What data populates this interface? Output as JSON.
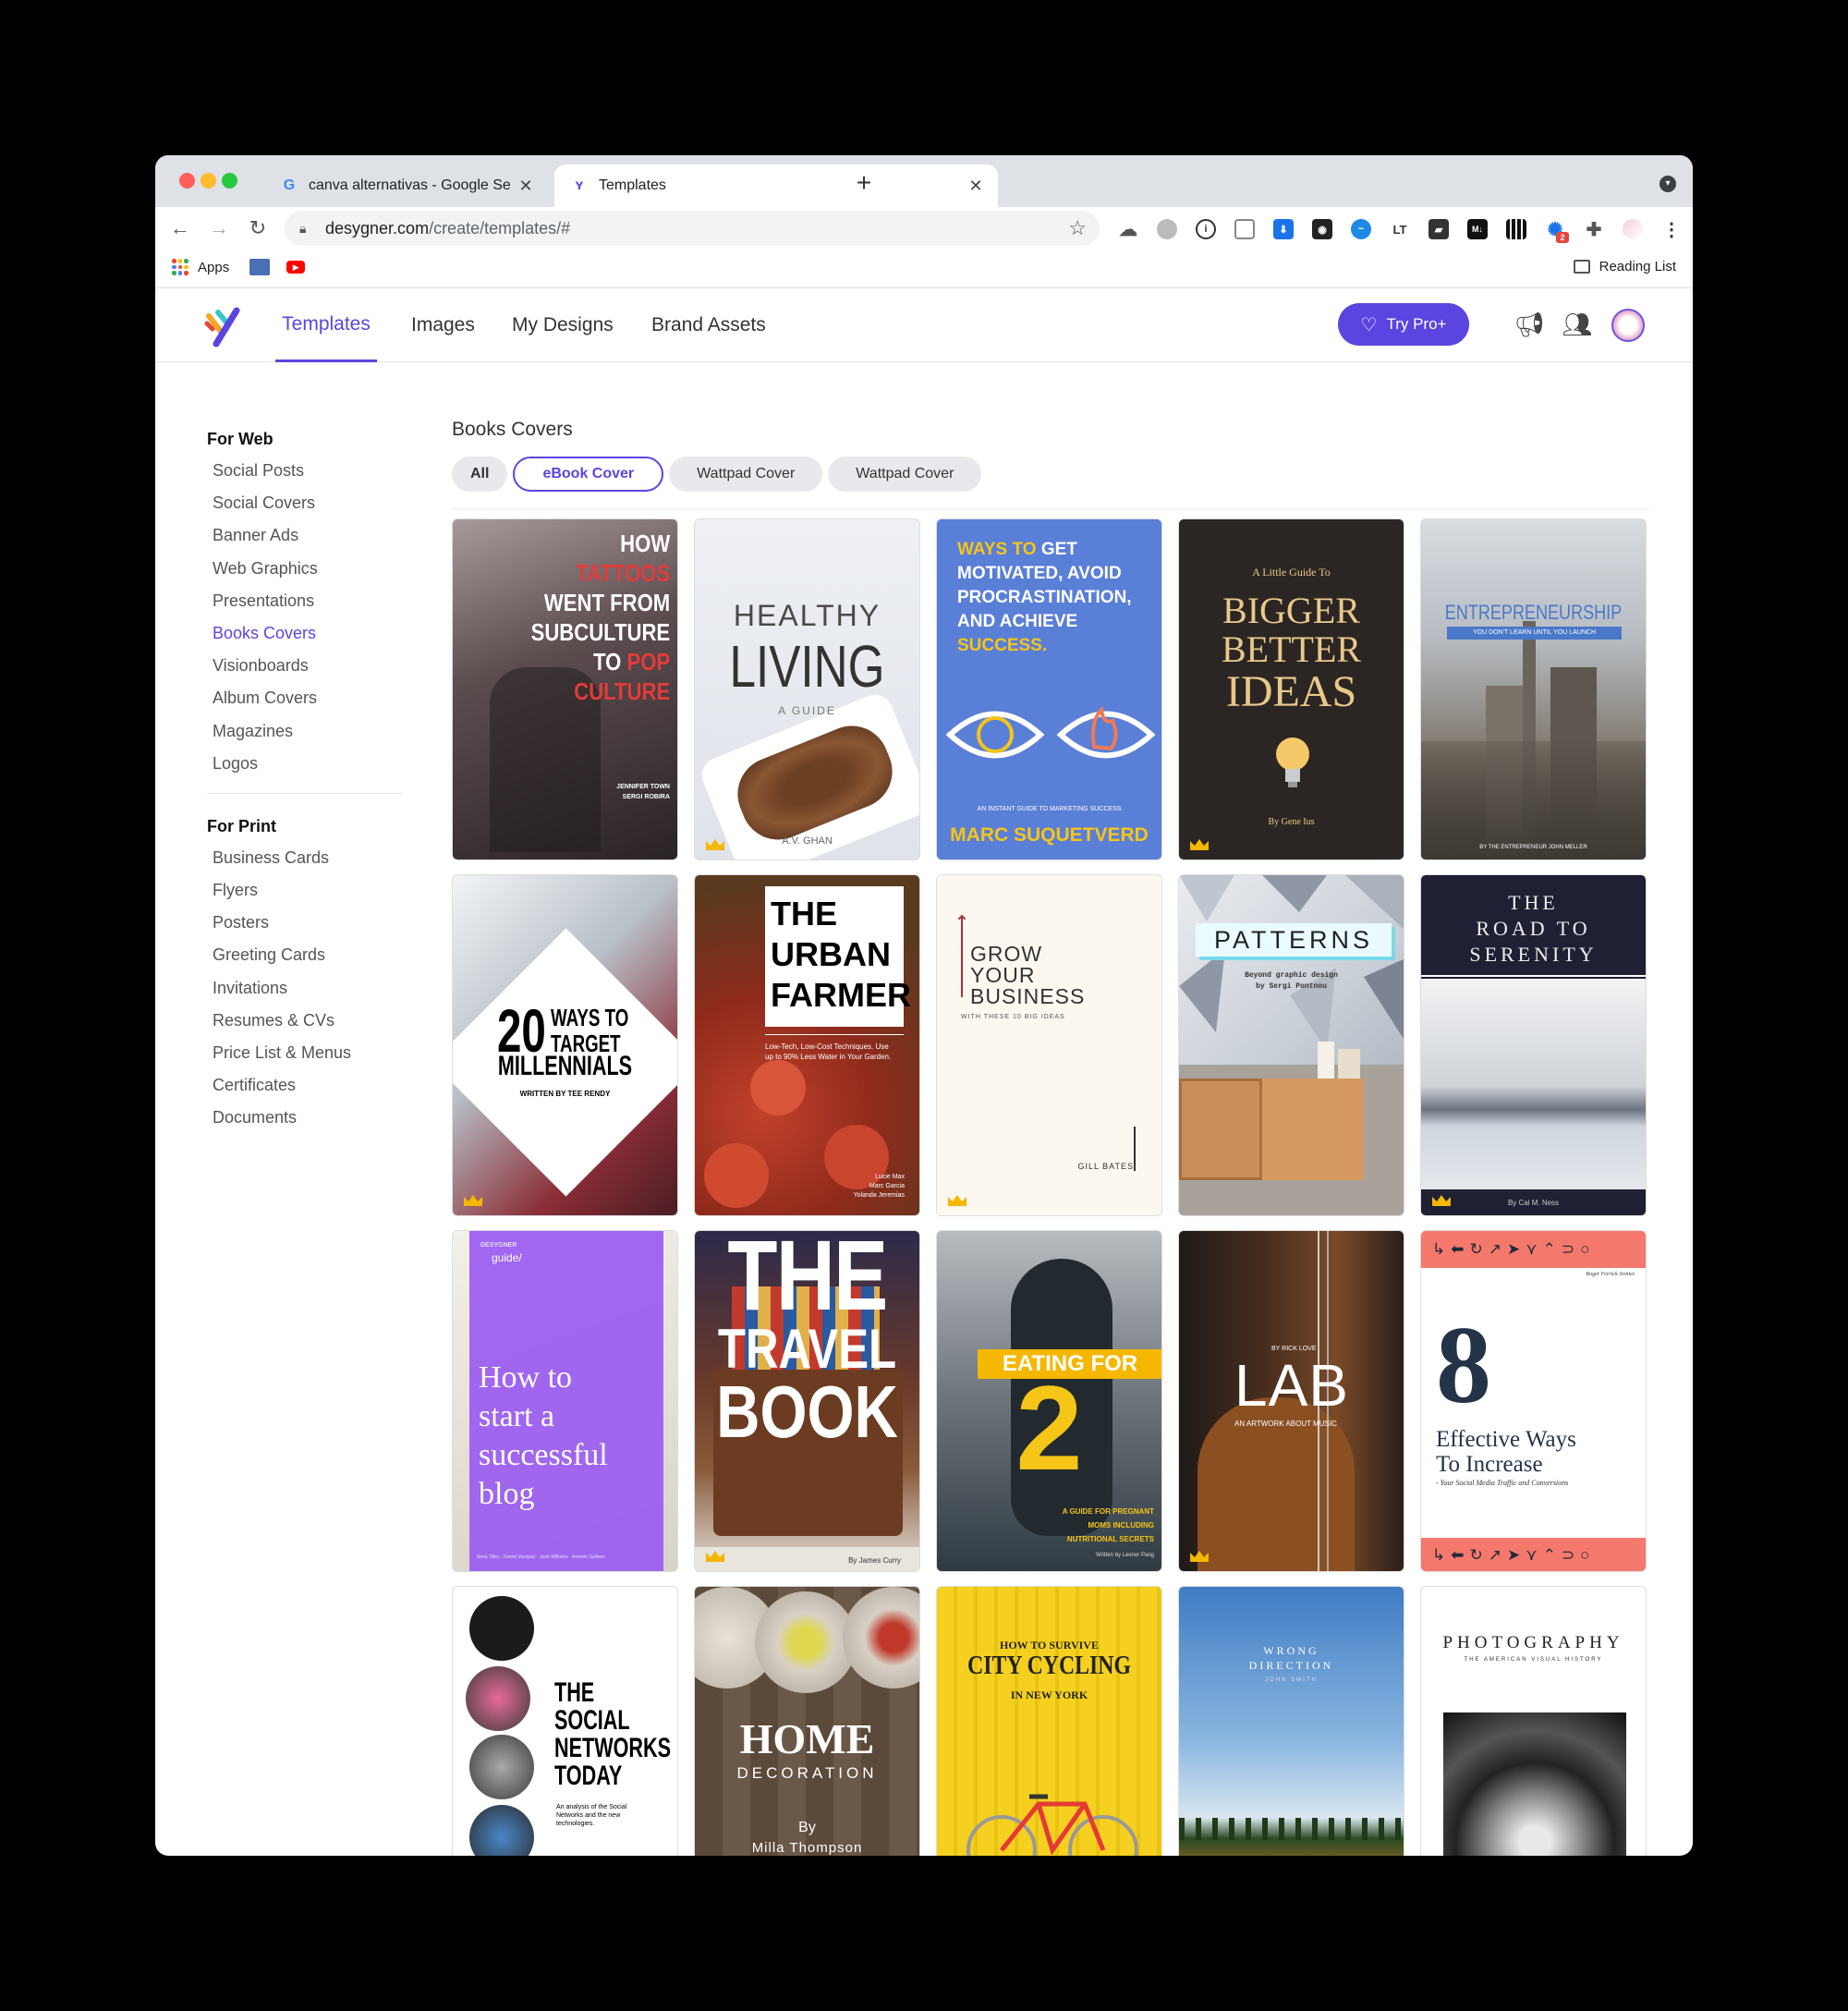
{
  "browser": {
    "tabs": [
      {
        "title": "canva alternativas - Google Se",
        "favicon": "google-icon",
        "active": false
      },
      {
        "title": "Templates",
        "favicon": "desygner-icon",
        "active": true
      }
    ],
    "url_host": "desygner.com",
    "url_path": "/create/templates/#",
    "bookmarks": {
      "apps_label": "Apps",
      "reading_list_label": "Reading List"
    },
    "extension_badge": "2"
  },
  "site": {
    "nav": [
      "Templates",
      "Images",
      "My Designs",
      "Brand Assets"
    ],
    "active_nav": "Templates",
    "try_pro_label": "Try Pro+",
    "accent_color": "#5b45e0"
  },
  "sidebar": {
    "web_heading": "For Web",
    "web_items": [
      "Social Posts",
      "Social Covers",
      "Banner Ads",
      "Web Graphics",
      "Presentations",
      "Books Covers",
      "Visionboards",
      "Album Covers",
      "Magazines",
      "Logos"
    ],
    "print_heading": "For Print",
    "print_items": [
      "Business Cards",
      "Flyers",
      "Posters",
      "Greeting Cards",
      "Invitations",
      "Resumes & CVs",
      "Price List & Menus",
      "Certificates",
      "Documents"
    ],
    "active_item": "Books Covers"
  },
  "content": {
    "title": "Books Covers",
    "filters": [
      "All",
      "eBook Cover",
      "Wattpad Cover",
      "Wattpad Cover"
    ],
    "selected_filter": "eBook Cover"
  },
  "covers": {
    "c1": {
      "l1": "HOW",
      "l2": "TATTOOS",
      "l3": "WENT FROM",
      "l4": "SUBCULTURE",
      "l5a": "TO ",
      "l5b": "POP",
      "l6": "CULTURE",
      "a1": "JENNIFER TOWN",
      "a2": "SERGI ROBIRA"
    },
    "c2": {
      "l1": "HEALTHY",
      "l2": "LIVING",
      "l3": "A GUIDE",
      "author": "A.V. GHAN"
    },
    "c3": {
      "l1a": "WAYS TO ",
      "l1b": "GET",
      "l2": "MOTIVATED, AVOID",
      "l3": "PROCRASTINATION,",
      "l4": "AND ACHIEVE",
      "l5": "SUCCESS.",
      "sub": "AN INSTANT GUIDE TO MARKETING SUCCESS",
      "author": "MARC SUQUETVERD"
    },
    "c4": {
      "pre": "A Little Guide To",
      "l1": "BIGGER",
      "l2": "BETTER",
      "l3": "IDEAS",
      "author": "By Gene Ius"
    },
    "c5": {
      "title": "ENTREPRENEURSHIP",
      "banner": "YOU DON'T LEARN UNTIL YOU LAUNCH",
      "author": "BY THE ENTREPRENEUR JOHN MELLER"
    },
    "c6": {
      "n": "20",
      "l1": "WAYS TO",
      "l2": "TARGET",
      "l3": "MILLENNIALS",
      "by": "WRITTEN BY TEE RENDY"
    },
    "c7": {
      "l1": "THE",
      "l2": "URBAN",
      "l3": "FARMER",
      "desc": "Low-Tech, Low-Cost Techniques. Use up to 90% Less Water in Your Garden.",
      "a1": "Lucie Max",
      "a2": "Marc Garcia",
      "a3": "Yolanda Jeremias"
    },
    "c8": {
      "l1": "GROW",
      "l2": "YOUR",
      "l3": "BUSINESS",
      "sub": "WITH THESE 10 BIG IDEAS",
      "author": "GILL BATES"
    },
    "c9": {
      "title": "PATTERNS",
      "sub1": "Beyond graphic design",
      "sub2": "by Sergi Pontnou"
    },
    "c10": {
      "l1": "THE",
      "l2": "ROAD TO",
      "l3": "SERENITY",
      "author": "By Cal M. Ness"
    },
    "c11": {
      "brand": "DESYGNER",
      "guide": "guide/",
      "l1": "How to",
      "l2": "start a",
      "l3": "successful",
      "l4": "blog",
      "footer": "Anna Tilley · Daniel Vazquez · Jane Williams · Antonio Sullivan"
    },
    "c12": {
      "l1": "THE",
      "l2": "TRAVEL",
      "l3": "BOOK",
      "author": "By James Curry"
    },
    "c13": {
      "l1": "EATING FOR",
      "n": "2",
      "sub1": "A GUIDE FOR PREGNANT",
      "sub2": "MOMS INCLUDING",
      "sub3": "NUTRITIONAL SECRETS",
      "author": "Written by Leonor Pang"
    },
    "c14": {
      "by": "BY RICK LOVE",
      "title": "LAB",
      "sub": "AN ARTWORK ABOUT MUSIC"
    },
    "c15": {
      "author": "Roger Ferrick Armies",
      "n": "8",
      "l1": "Effective Ways",
      "l2": "To Increase",
      "sub": "- Your Social Media Traffic and Conversions"
    },
    "c16": {
      "l1": "THE",
      "l2": "SOCIAL",
      "l3": "NETWORKS",
      "l4": "TODAY",
      "desc": "An analysis of the Social Networks and the new technologies."
    },
    "c17": {
      "l1": "HOME",
      "l2": "DECORATION",
      "by": "By",
      "author": "Milla Thompson"
    },
    "c18": {
      "pre": "HOW TO SURVIVE",
      "title": "CITY CYCLING",
      "sub": "IN NEW YORK"
    },
    "c19": {
      "l1": "WRONG",
      "l2": "DIRECTION",
      "author": "JOHN SMITH"
    },
    "c20": {
      "title": "PHOTOGRAPHY",
      "sub": "THE AMERICAN VISUAL HISTORY"
    }
  }
}
